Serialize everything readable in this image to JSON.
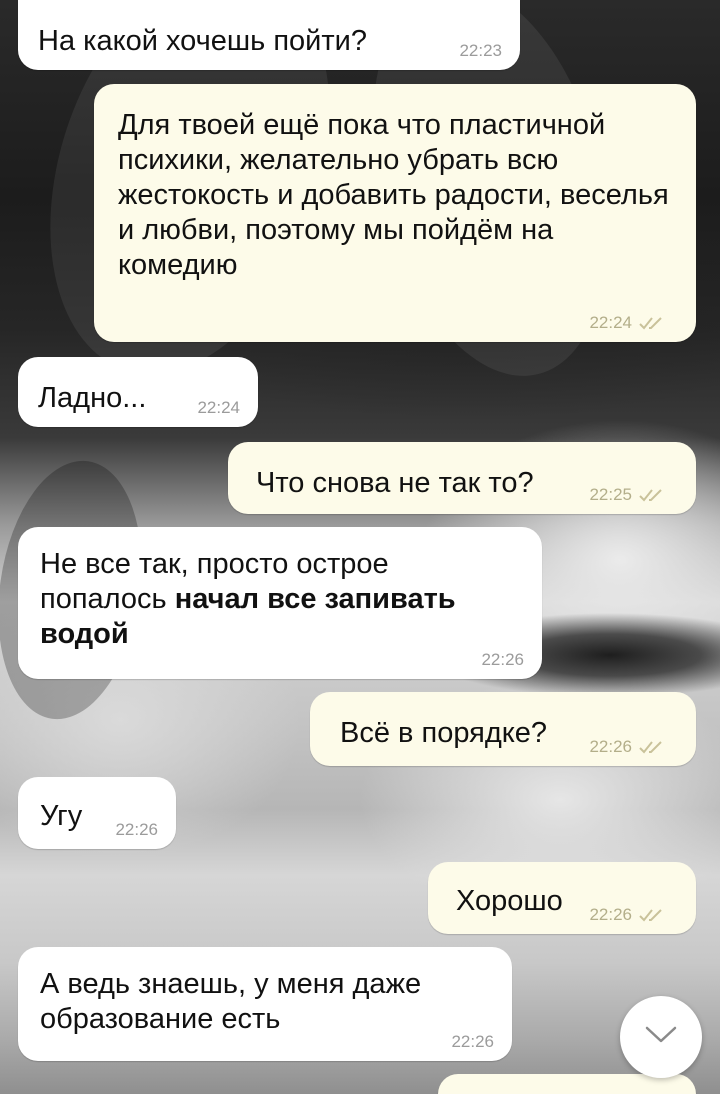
{
  "messages": [
    {
      "direction": "in",
      "text": "На какой хочешь пойти?",
      "time": "22:23"
    },
    {
      "direction": "out",
      "text": "Для твоей ещё пока что пластичной психики, желательно убрать всю жестокость и добавить радости, веселья и любви, поэтому мы пойдём на комедию",
      "time": "22:24",
      "status": "read-double-check"
    },
    {
      "direction": "in",
      "text": "Ладно...",
      "time": "22:24"
    },
    {
      "direction": "out",
      "text": "Что снова не так то?",
      "time": "22:25",
      "status": "read-double-check"
    },
    {
      "direction": "in",
      "text_normal": "Не все так, просто острое попалось ",
      "text_bold": "начал все запивать водой",
      "time": "22:26"
    },
    {
      "direction": "out",
      "text": "Всё в порядке?",
      "time": "22:26",
      "status": "read-double-check"
    },
    {
      "direction": "in",
      "text": "Угу",
      "time": "22:26"
    },
    {
      "direction": "out",
      "text": "Хорошо",
      "time": "22:26",
      "status": "read-double-check"
    },
    {
      "direction": "in",
      "text": "А ведь знаешь, у меня даже образование есть",
      "time": "22:26"
    }
  ],
  "scroll_button": {
    "icon": "chevron-down-icon"
  },
  "colors": {
    "incoming_bubble": "#ffffff",
    "outgoing_bubble": "#fdfbe9",
    "outgoing_time": "#b3ae8a",
    "incoming_time": "#9b9b9b",
    "check_mark": "#c9c29a"
  }
}
